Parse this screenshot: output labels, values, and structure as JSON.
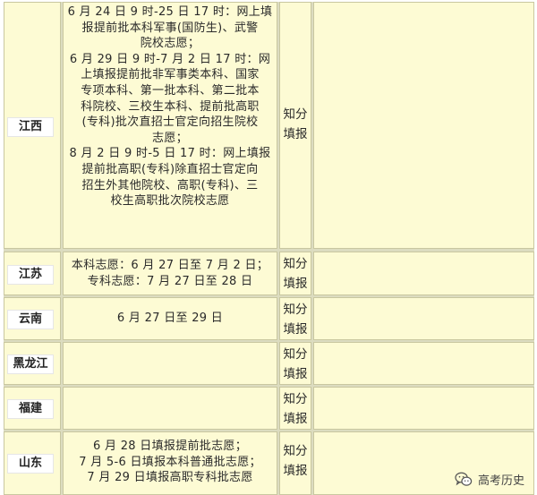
{
  "rows": [
    {
      "province": "江西",
      "time_lines": [
        "6 月 24 日 9 时-25 日 17 时：网上填",
        "报提前批本科军事(国防生)、武警",
        "院校志愿；",
        "6 月 29 日 9 时-7 月 2 日 17 时：网",
        "上填报提前批非军事类本科、国家",
        "专项本科、第一批本科、第二批本",
        "科院校、三校生本科、提前批高职",
        "(专科)批次直招士官定向招生院校",
        "志愿；",
        "8 月 2 日 9 时-5 日 17 时：网上填报",
        "提前批高职(专科)除直招士官定向",
        "招生外其他院校、高职(专科)、三",
        "校生高职批次院校志愿"
      ],
      "method_lines": [
        "知分",
        "填报"
      ]
    },
    {
      "province": "江苏",
      "time_lines": [
        "本科志愿：6 月 27 日至 7 月 2 日；",
        "专科志愿：7 月 27 日至 28 日"
      ],
      "method_lines": [
        "知分",
        "填报"
      ]
    },
    {
      "province": "云南",
      "time_lines": [
        "6 月 27 日至 29 日"
      ],
      "method_lines": [
        "知分",
        "填报"
      ]
    },
    {
      "province": "黑龙江",
      "time_lines": [],
      "method_lines": [
        "知分",
        "填报"
      ]
    },
    {
      "province": "福建",
      "time_lines": [],
      "method_lines": [
        "知分",
        "填报"
      ]
    },
    {
      "province": "山东",
      "time_lines": [
        "6 月 28 日填报提前批志愿；",
        "7 月 5-6 日填报本科普通批志愿；",
        "7 月 29 日填报高职专科批志愿"
      ],
      "method_lines": [
        "知分",
        "填报"
      ]
    }
  ],
  "watermark": {
    "text": "高考历史",
    "icon": "wechat-icon"
  },
  "colors": {
    "cell_background": "#fdfbd4",
    "grid_background": "#dcdcc0",
    "province_background": "#ffffff"
  }
}
